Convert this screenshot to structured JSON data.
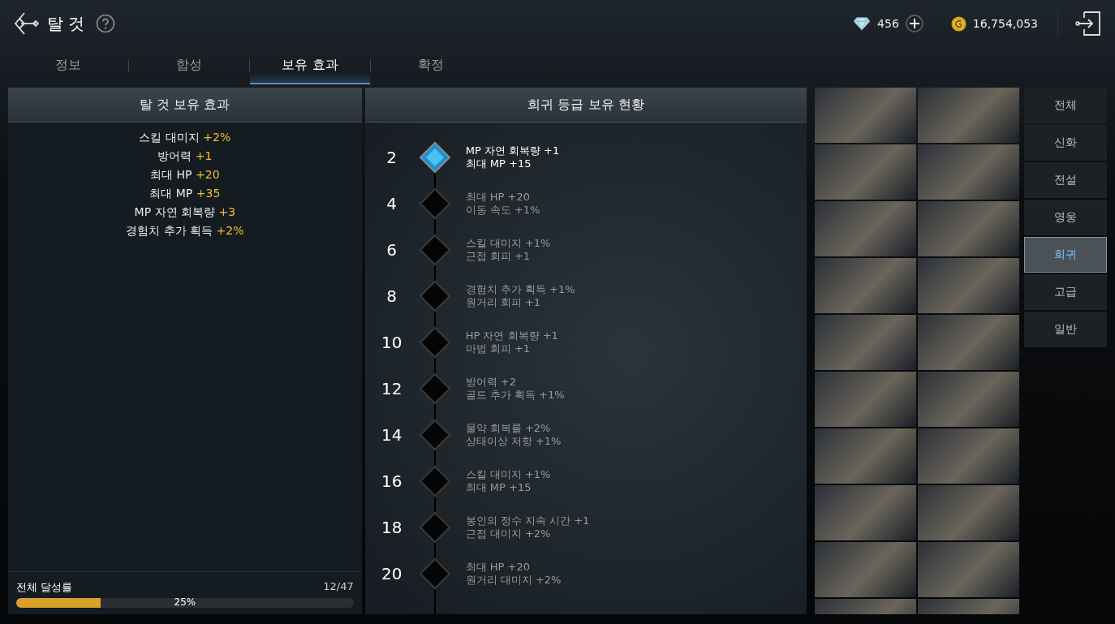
{
  "header": {
    "title": "탈 것",
    "diamonds": "456",
    "gold": "16,754,053"
  },
  "tabs": [
    {
      "label": "정보",
      "selected": false
    },
    {
      "label": "합성",
      "selected": false
    },
    {
      "label": "보유 효과",
      "selected": true
    },
    {
      "label": "확정",
      "selected": false
    }
  ],
  "effects_panel": {
    "title": "탈 것 보유 효과",
    "effects": [
      {
        "name": "스킬 대미지",
        "value": "+2%"
      },
      {
        "name": "방어력",
        "value": "+1"
      },
      {
        "name": "최대 HP",
        "value": "+20"
      },
      {
        "name": "최대 MP",
        "value": "+35"
      },
      {
        "name": "MP 자연 회복량",
        "value": "+3"
      },
      {
        "name": "경험치 추가 획득",
        "value": "+2%"
      }
    ],
    "progress": {
      "label": "전체 달성률",
      "count": "12/47",
      "percent": "25%",
      "level": 0.25
    }
  },
  "milestones_panel": {
    "title": "희귀 등급 보유 현황",
    "milestones": [
      {
        "count": "2",
        "reached": true,
        "lines": [
          "MP 자연 회복량 +1",
          "최대 MP +15"
        ]
      },
      {
        "count": "4",
        "reached": false,
        "lines": [
          "최대 HP +20",
          "이동 속도 +1%"
        ]
      },
      {
        "count": "6",
        "reached": false,
        "lines": [
          "스킬 대미지 +1%",
          "근접 회피 +1"
        ]
      },
      {
        "count": "8",
        "reached": false,
        "lines": [
          "경험치 추가 획득 +1%",
          "원거리 회피 +1"
        ]
      },
      {
        "count": "10",
        "reached": false,
        "lines": [
          "HP 자연 회복량 +1",
          "마법 회피 +1"
        ]
      },
      {
        "count": "12",
        "reached": false,
        "lines": [
          "방어력 +2",
          "골드 추가 획득 +1%"
        ]
      },
      {
        "count": "14",
        "reached": false,
        "lines": [
          "물약 회복률 +2%",
          "상태이상 저항 +1%"
        ]
      },
      {
        "count": "16",
        "reached": false,
        "lines": [
          "스킬 대미지 +1%",
          "최대 MP +15"
        ]
      },
      {
        "count": "18",
        "reached": false,
        "lines": [
          "봉인의 정수 지속 시간 +1",
          "근접 대미지 +2%"
        ]
      },
      {
        "count": "20",
        "reached": false,
        "lines": [
          "최대 HP +20",
          "원거리 대미지 +2%"
        ]
      }
    ]
  },
  "grade_filters": [
    {
      "label": "전체",
      "selected": false
    },
    {
      "label": "신화",
      "selected": false
    },
    {
      "label": "전설",
      "selected": false
    },
    {
      "label": "영웅",
      "selected": false
    },
    {
      "label": "희귀",
      "selected": true
    },
    {
      "label": "고급",
      "selected": false
    },
    {
      "label": "일반",
      "selected": false
    }
  ]
}
